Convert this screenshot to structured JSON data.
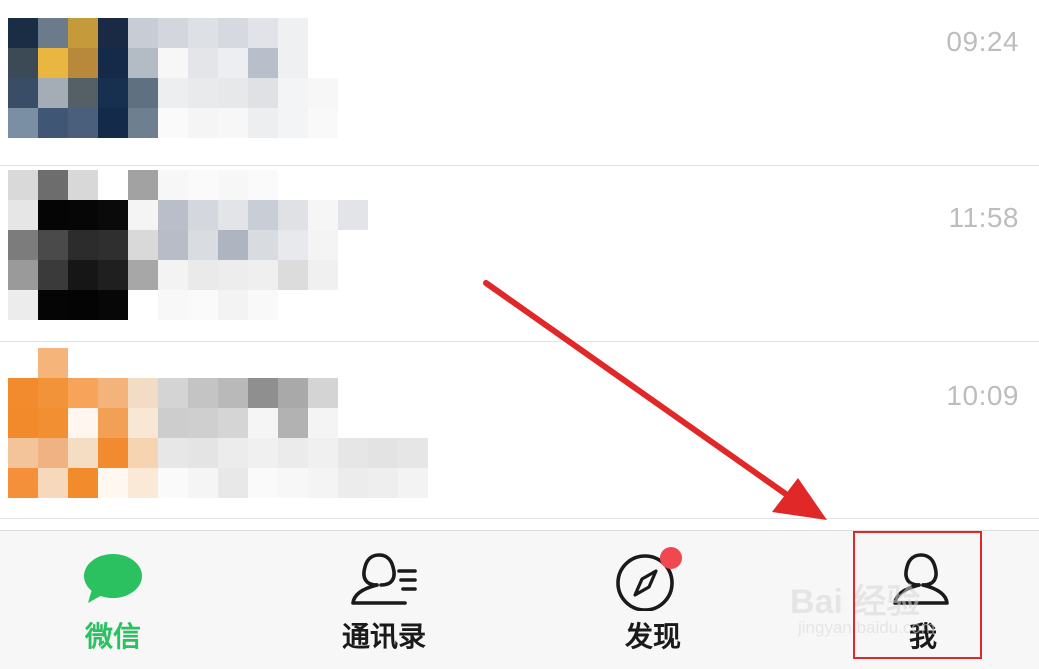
{
  "chats": [
    {
      "time": "09:24"
    },
    {
      "time": "11:58"
    },
    {
      "time": "10:09"
    }
  ],
  "tabs": [
    {
      "label": "微信",
      "icon": "chat-bubble-icon",
      "active": true
    },
    {
      "label": "通讯录",
      "icon": "contacts-icon",
      "active": false
    },
    {
      "label": "发现",
      "icon": "compass-icon",
      "active": false,
      "badge": true
    },
    {
      "label": "我",
      "icon": "person-icon",
      "active": false
    }
  ],
  "watermark": {
    "main": "Bai 经验",
    "sub": "jingyan.baidu.com"
  },
  "colors": {
    "accent": "#2bc060",
    "badge": "#f1484f",
    "annotation": "#e02828"
  }
}
